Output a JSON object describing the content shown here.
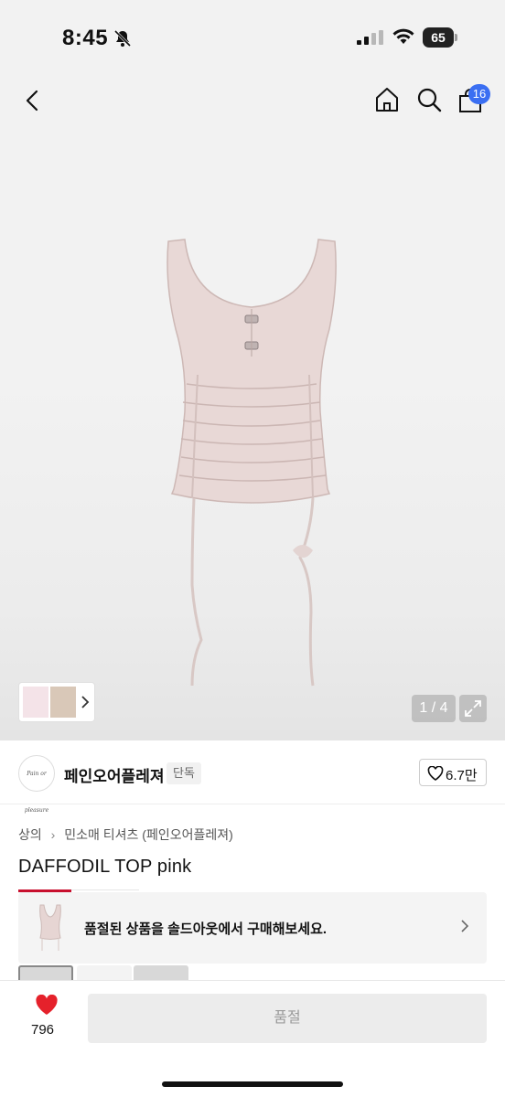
{
  "status_bar": {
    "time": "8:45",
    "battery": "65",
    "icons": [
      "bell-slash-icon",
      "signal-icon",
      "wifi-icon",
      "battery-icon"
    ]
  },
  "nav": {
    "icons": [
      "back-chevron-icon",
      "home-icon",
      "search-icon",
      "cart-icon"
    ],
    "cart_badge": "16"
  },
  "gallery": {
    "counter": "1 / 4",
    "icons": [
      "expand-icon",
      "chevron-right-icon"
    ],
    "product_color": "#e8d8d6"
  },
  "brand": {
    "logo_text": "Pain or pleasure",
    "name": "페인오어플레져",
    "tag": "단독",
    "like_count": "6.7만"
  },
  "breadcrumb": {
    "items": [
      "상의",
      "민소매 티셔츠 (페인오어플레져)"
    ]
  },
  "product": {
    "title": "DAFFODIL TOP pink"
  },
  "soldout_banner": {
    "text": "품절된 상품을 솔드아웃에서 구매해보세요."
  },
  "bottom_bar": {
    "wish_count": "796",
    "buy_label": "품절",
    "heart_color": "#e5212b"
  },
  "colors": {
    "accent_red": "#c8102e",
    "badge_blue": "#3b6ff2"
  }
}
